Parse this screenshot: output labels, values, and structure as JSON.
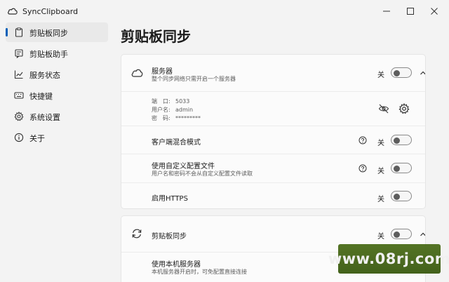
{
  "window": {
    "title": "SyncClipboard"
  },
  "sidebar": {
    "items": [
      {
        "label": "剪贴板同步",
        "icon": "clipboard-icon",
        "active": true
      },
      {
        "label": "剪贴板助手",
        "icon": "clipboard-assistant-icon",
        "active": false
      },
      {
        "label": "服务状态",
        "icon": "chart-icon",
        "active": false
      },
      {
        "label": "快捷键",
        "icon": "keyboard-icon",
        "active": false
      },
      {
        "label": "系统设置",
        "icon": "gear-icon",
        "active": false
      },
      {
        "label": "关于",
        "icon": "info-icon",
        "active": false
      }
    ]
  },
  "page": {
    "title": "剪贴板同步"
  },
  "server_card": {
    "title": "服务器",
    "subtitle": "整个同步网络只需开启一个服务器",
    "toggle_label": "关",
    "details": {
      "port_key": "端　口:",
      "port_value": "5033",
      "user_key": "用户名:",
      "user_value": "admin",
      "pass_key": "密　码:",
      "pass_value": "*********"
    },
    "rows": [
      {
        "title": "客户端混合模式",
        "subtitle": "",
        "toggle_label": "关",
        "help": true
      },
      {
        "title": "使用自定义配置文件",
        "subtitle": "用户名和密码不会从自定义配置文件读取",
        "toggle_label": "关",
        "help": true
      },
      {
        "title": "启用HTTPS",
        "subtitle": "",
        "toggle_label": "关",
        "help": false
      }
    ]
  },
  "sync_card": {
    "title": "剪贴板同步",
    "toggle_label": "关",
    "rows": [
      {
        "title": "使用本机服务器",
        "subtitle": "本机服务器开启时，可免配置直接连接"
      }
    ]
  },
  "watermark": {
    "text": "www.08rj.com"
  },
  "colors": {
    "accent": "#005fb8",
    "background": "#f3f3f3",
    "card": "#fbfbfb"
  }
}
